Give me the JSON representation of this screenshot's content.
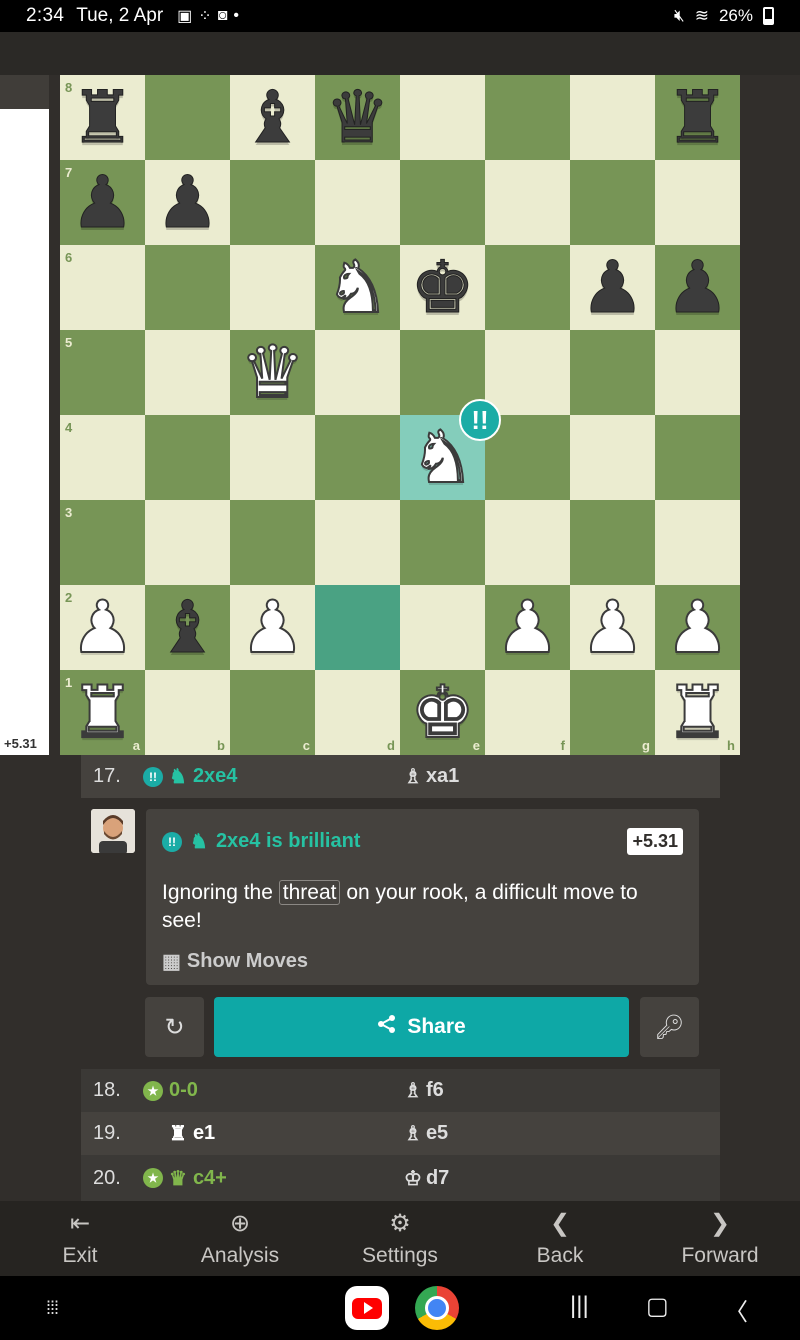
{
  "status": {
    "time": "2:34",
    "date": "Tue, 2 Apr",
    "battery": "26%"
  },
  "eval": "+5.31",
  "board": {
    "ranks": [
      "8",
      "7",
      "6",
      "5",
      "4",
      "3",
      "2",
      "1"
    ],
    "files": [
      "a",
      "b",
      "c",
      "d",
      "e",
      "f",
      "g",
      "h"
    ],
    "pieces": {
      "a8": "bR",
      "c8": "bB",
      "d8": "bQ",
      "h8": "bR",
      "a7": "bP",
      "b7": "bP",
      "d6": "wN",
      "e6": "bK",
      "g6": "bP",
      "h6": "bP",
      "c5": "wQ",
      "e4": "wN",
      "a2": "wP",
      "b2": "bB",
      "c2": "wP",
      "f2": "wP",
      "g2": "wP",
      "h2": "wP",
      "a1": "wR",
      "e1": "wK",
      "h1": "wR"
    },
    "highlight_from": "d2",
    "highlight_to": "e4",
    "badge_square": "e4",
    "badge_label": "!!"
  },
  "moves": {
    "m17": {
      "num": "17.",
      "white": "2xe4",
      "black": "xa1"
    },
    "m18": {
      "num": "18.",
      "white": "0-0",
      "black": "f6"
    },
    "m19": {
      "num": "19.",
      "white": "e1",
      "black": "e5"
    },
    "m20": {
      "num": "20.",
      "white": "c4+",
      "black": "d7"
    }
  },
  "coach": {
    "badge": "!!",
    "title": "2xe4 is brilliant",
    "eval": "+5.31",
    "message_pre": "Ignoring the",
    "keyword": "threat",
    "message_post": "on your rook, a difficult move to see!",
    "show_moves": "Show Moves"
  },
  "actions": {
    "share": "Share"
  },
  "nav": {
    "exit": "Exit",
    "analysis": "Analysis",
    "settings": "Settings",
    "back": "Back",
    "forward": "Forward"
  }
}
